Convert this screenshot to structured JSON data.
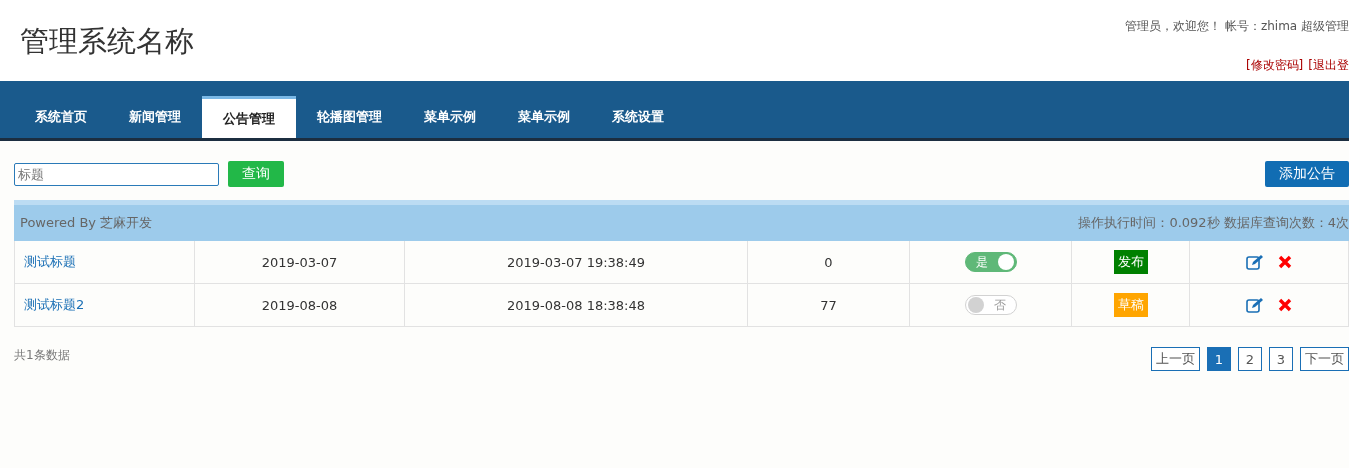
{
  "header": {
    "title": "管理系统名称",
    "welcome": "管理员，欢迎您！ 帐号：zhima 超级管理",
    "links": [
      "[修改密码]",
      "[退出登"
    ]
  },
  "nav": [
    {
      "label": "系统首页",
      "selected": false
    },
    {
      "label": "新闻管理",
      "selected": false
    },
    {
      "label": "公告管理",
      "selected": true
    },
    {
      "label": "轮播图管理",
      "selected": false
    },
    {
      "label": "菜单示例",
      "selected": false
    },
    {
      "label": "菜单示例",
      "selected": false
    },
    {
      "label": "系统设置",
      "selected": false
    }
  ],
  "toolbar": {
    "search": {
      "placeholder": "标题"
    },
    "search_button": "查询",
    "add_button": "添加公告"
  },
  "info_bar": {
    "powered": "Powered By 芝麻开发",
    "stats": "操作执行时间：0.092秒 数据库查询次数：4次"
  },
  "rows": [
    {
      "title": "测试标题",
      "date": "2019-03-07",
      "time": "2019-03-07 19:38:49",
      "count": "0",
      "toggle": {
        "on": true,
        "label": "是"
      },
      "status": {
        "label": "发布",
        "color": "#008000"
      }
    },
    {
      "title": "测试标题2",
      "date": "2019-08-08",
      "time": "2019-08-08 18:38:48",
      "count": "77",
      "toggle": {
        "on": false,
        "label": "否"
      },
      "status": {
        "label": "草稿",
        "color": "#ffa500"
      }
    }
  ],
  "footer": {
    "total": "共1条数据",
    "pagination": [
      {
        "label": "上一页",
        "kind": "prev",
        "selected": false
      },
      {
        "label": "1",
        "kind": "page",
        "selected": true
      },
      {
        "label": "2",
        "kind": "page",
        "selected": false
      },
      {
        "label": "3",
        "kind": "page",
        "selected": false
      },
      {
        "label": "下一页",
        "kind": "next",
        "selected": false
      }
    ]
  }
}
